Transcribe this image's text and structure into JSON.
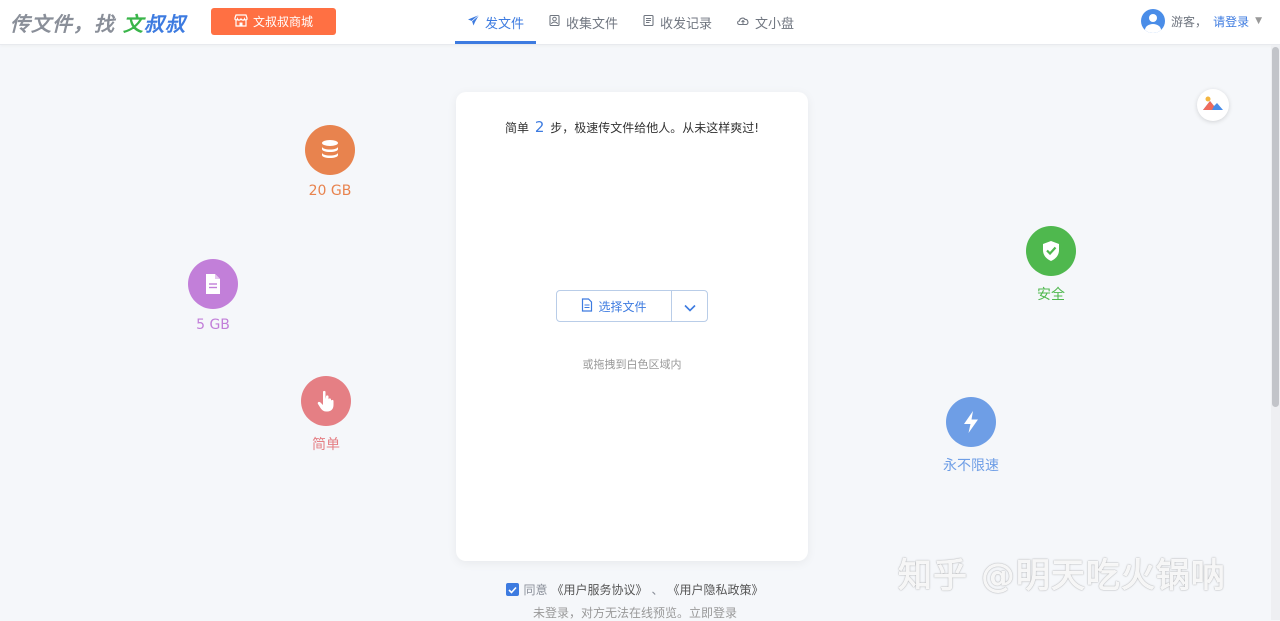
{
  "header": {
    "logo_slogan": "传文件，找 ",
    "logo_brand_part1": "文",
    "logo_brand_part2": "叔叔",
    "shop_button": "文叔叔商城",
    "nav": [
      {
        "label": "发文件",
        "icon": "send-icon",
        "active": true
      },
      {
        "label": "收集文件",
        "icon": "collect-icon",
        "active": false
      },
      {
        "label": "收发记录",
        "icon": "record-icon",
        "active": false
      },
      {
        "label": "文小盘",
        "icon": "cloud-disk-icon",
        "active": false
      }
    ],
    "user": {
      "guest": "游客，",
      "login": "请登录"
    }
  },
  "features": [
    {
      "label": "20 GB",
      "icon": "database-icon",
      "color": "#e8834e"
    },
    {
      "label": "5 GB",
      "icon": "file-icon",
      "color": "#c27fd9"
    },
    {
      "label": "简单",
      "icon": "hand-pointer-icon",
      "color": "#e57f84"
    },
    {
      "label": "安全",
      "icon": "shield-check-icon",
      "color": "#4fb84e"
    },
    {
      "label": "永不限速",
      "icon": "lightning-icon",
      "color": "#6e9ee6"
    }
  ],
  "card": {
    "title_pre": "简单",
    "title_num": "2",
    "title_post": "步，极速传文件给他人。从未这样爽过!",
    "select_button": "选择文件",
    "drag_hint": "或拖拽到白色区域内"
  },
  "agreement": {
    "prefix": "同意",
    "terms": "《用户服务协议》",
    "sep": "、",
    "privacy": "《用户隐私政策》",
    "note": "未登录，对方无法在线预览。",
    "login_link": "立即登录"
  },
  "watermark": "知乎 @明天吃火锅呐",
  "colors": {
    "accent": "#3d7be0",
    "brand_green": "#3ab54a",
    "shop_orange": "#ff7043"
  }
}
